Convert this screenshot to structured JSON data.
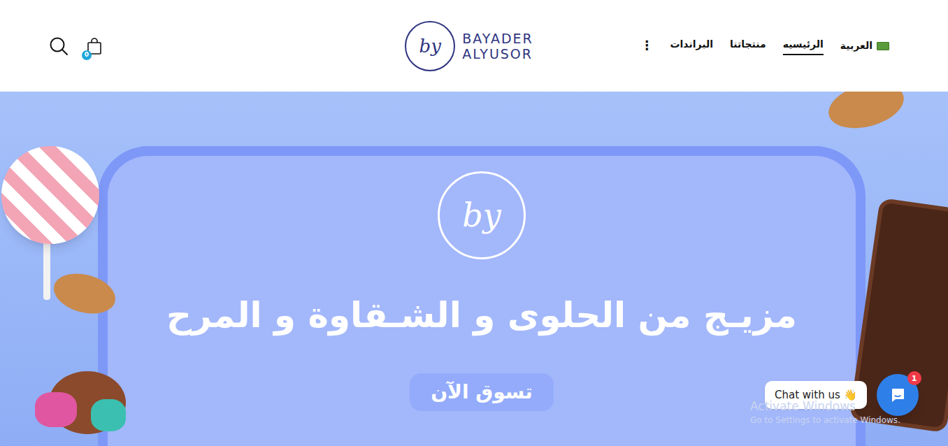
{
  "header": {
    "language": {
      "label": "العربية"
    },
    "nav": [
      {
        "label": "الرئيسيه",
        "selected": true
      },
      {
        "label": "منتجاتنا",
        "selected": false
      },
      {
        "label": "البراندات",
        "selected": false
      }
    ],
    "more": "⋮",
    "logo": {
      "mark": "by",
      "line1": "BAYADER",
      "line2": "ALYUSOR"
    },
    "cart": {
      "count": "0"
    }
  },
  "hero": {
    "mark": "by",
    "heading": "مزيـج من الحلوى و الشـقاوة و المرح",
    "button": "تسوق الآن"
  },
  "chat": {
    "label": "Chat with us 👋",
    "badge": "1"
  },
  "watermark": {
    "title": "Activate Windows",
    "subtitle": "Go to Settings to activate Windows."
  }
}
